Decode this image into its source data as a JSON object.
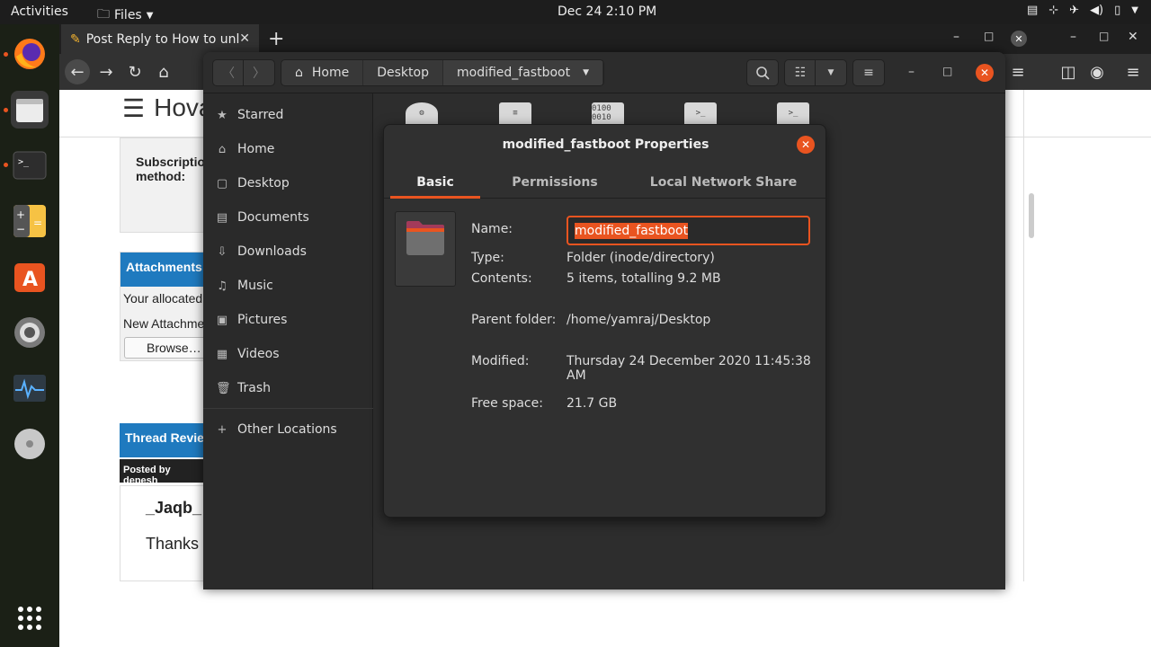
{
  "topbar": {
    "activities": "Activities",
    "app_name": "Files",
    "clock": "Dec 24  2:10 PM"
  },
  "browser": {
    "tab_title": "Post Reply to How to unl",
    "site_logo": "Hova",
    "subscription_label": "Subscription method:",
    "attachments_title": "Attachments",
    "your_allocated": "Your allocated",
    "new_attachment": "New Attachme",
    "browse_button": "Browse…",
    "thread_review_title": "Thread Revie",
    "posted_by": "Posted by depesh",
    "post_user": "_Jaqb_",
    "post_text": "Thanks"
  },
  "files": {
    "path": [
      "Home",
      "Desktop",
      "modified_fastboot"
    ],
    "sidebar": [
      {
        "label": "Starred",
        "icon": "star-icon"
      },
      {
        "label": "Home",
        "icon": "home-icon"
      },
      {
        "label": "Desktop",
        "icon": "desktop-icon"
      },
      {
        "label": "Documents",
        "icon": "document-icon"
      },
      {
        "label": "Downloads",
        "icon": "download-icon"
      },
      {
        "label": "Music",
        "icon": "music-icon"
      },
      {
        "label": "Pictures",
        "icon": "picture-icon"
      },
      {
        "label": "Videos",
        "icon": "video-icon"
      },
      {
        "label": "Trash",
        "icon": "trash-icon"
      }
    ],
    "other_locations": "Other Locations",
    "file_icon_labels": [
      "0100 0010",
      ">_",
      ">_"
    ]
  },
  "dialog": {
    "title": "modified_fastboot Properties",
    "tabs": [
      "Basic",
      "Permissions",
      "Local Network Share"
    ],
    "name_label": "Name:",
    "name_value": "modified_fastboot",
    "type_label": "Type:",
    "type_value": "Folder (inode/directory)",
    "contents_label": "Contents:",
    "contents_value": "5 items, totalling 9.2 MB",
    "parent_label": "Parent folder:",
    "parent_value": "/home/yamraj/Desktop",
    "modified_label": "Modified:",
    "modified_value": "Thursday 24 December 2020 11:45:38 AM",
    "free_label": "Free space:",
    "free_value": "21.7 GB"
  },
  "colors": {
    "accent": "#e95420",
    "link_blue": "#1f7abf"
  }
}
